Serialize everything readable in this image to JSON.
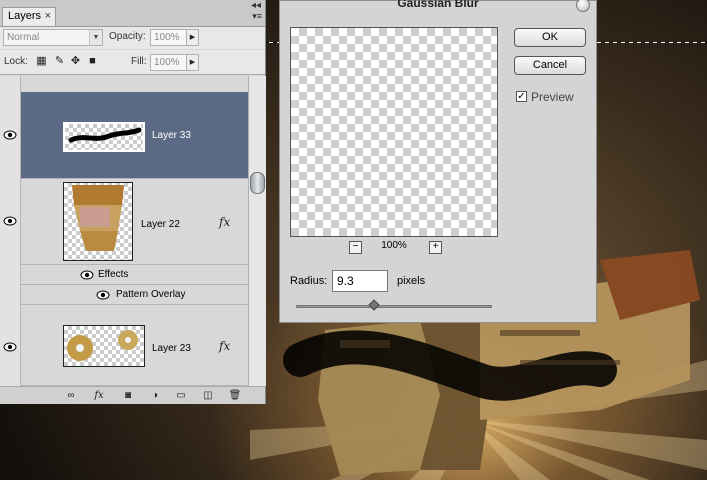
{
  "layers_panel": {
    "tab_label": "Layers",
    "tab_close": "×",
    "blend_mode": "Normal",
    "opacity_label": "Opacity:",
    "opacity_value": "100%",
    "lock_label": "Lock:",
    "fill_label": "Fill:",
    "fill_value": "100%",
    "layers": [
      {
        "name": "Layer 33",
        "selected": true,
        "fx": false
      },
      {
        "name": "Layer 22",
        "selected": false,
        "fx": true,
        "fx_label": "fx",
        "effects_label": "Effects",
        "effects": [
          "Pattern Overlay"
        ]
      },
      {
        "name": "Layer 23",
        "selected": false,
        "fx": true,
        "fx_label": "fx"
      }
    ],
    "bottom_icons": [
      "link-icon",
      "fx-icon",
      "mask-icon",
      "adjustment-icon",
      "folder-icon",
      "new-layer-icon",
      "trash-icon"
    ],
    "fx_text": "fx"
  },
  "dialog": {
    "title": "Gaussian Blur",
    "ok_label": "OK",
    "cancel_label": "Cancel",
    "preview_label": "Preview",
    "preview_checked": true,
    "zoom_value": "100%",
    "zoom_out": "−",
    "zoom_in": "+",
    "radius_label": "Radius:",
    "radius_value": "9.3",
    "radius_unit": "pixels",
    "radius_slider_fraction": 0.4
  },
  "colors": {
    "selection": "#5b6a85",
    "panel_bg": "#d6d6d6",
    "dialog_bg": "#d4d4d4"
  }
}
